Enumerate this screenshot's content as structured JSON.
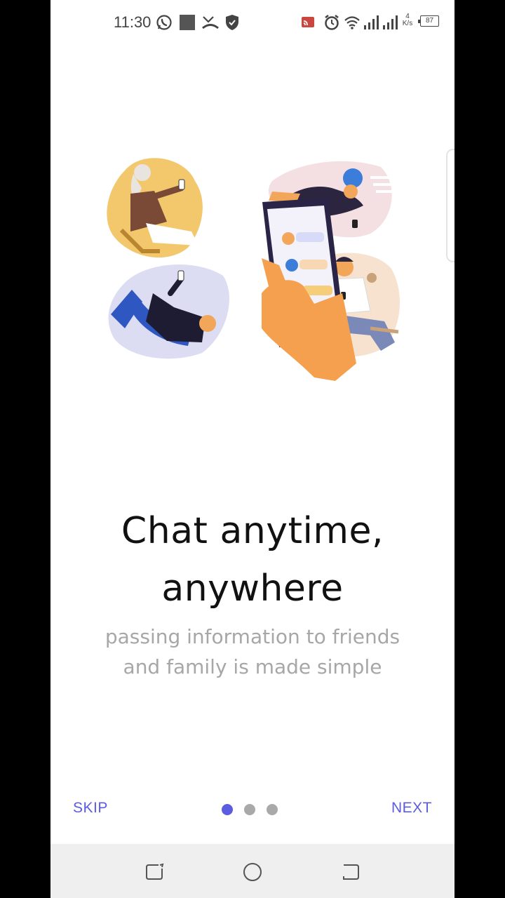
{
  "status_bar": {
    "time": "11:30",
    "battery": "87",
    "speed_top": "4",
    "speed_unit": "K/s"
  },
  "onboarding": {
    "title_line1": "Chat anytime,",
    "title_line2": "anywhere",
    "subtitle_line1": "passing information to friends",
    "subtitle_line2": "and family is made simple",
    "skip_label": "SKIP",
    "next_label": "NEXT",
    "page_indicator": {
      "total": 3,
      "active": 1
    }
  },
  "colors": {
    "accent": "#5c5ce0",
    "dot_inactive": "#a9a9a9",
    "subtitle": "#a7a7a7"
  },
  "icons": {
    "status_left": [
      "whatsapp-icon",
      "square-notification-icon",
      "missed-call-icon",
      "shield-icon"
    ],
    "status_right": [
      "cast-icon",
      "alarm-icon",
      "wifi-icon",
      "signal-icon",
      "signal-icon",
      "battery-icon"
    ],
    "nav": [
      "recents-icon",
      "home-icon",
      "back-icon"
    ]
  }
}
